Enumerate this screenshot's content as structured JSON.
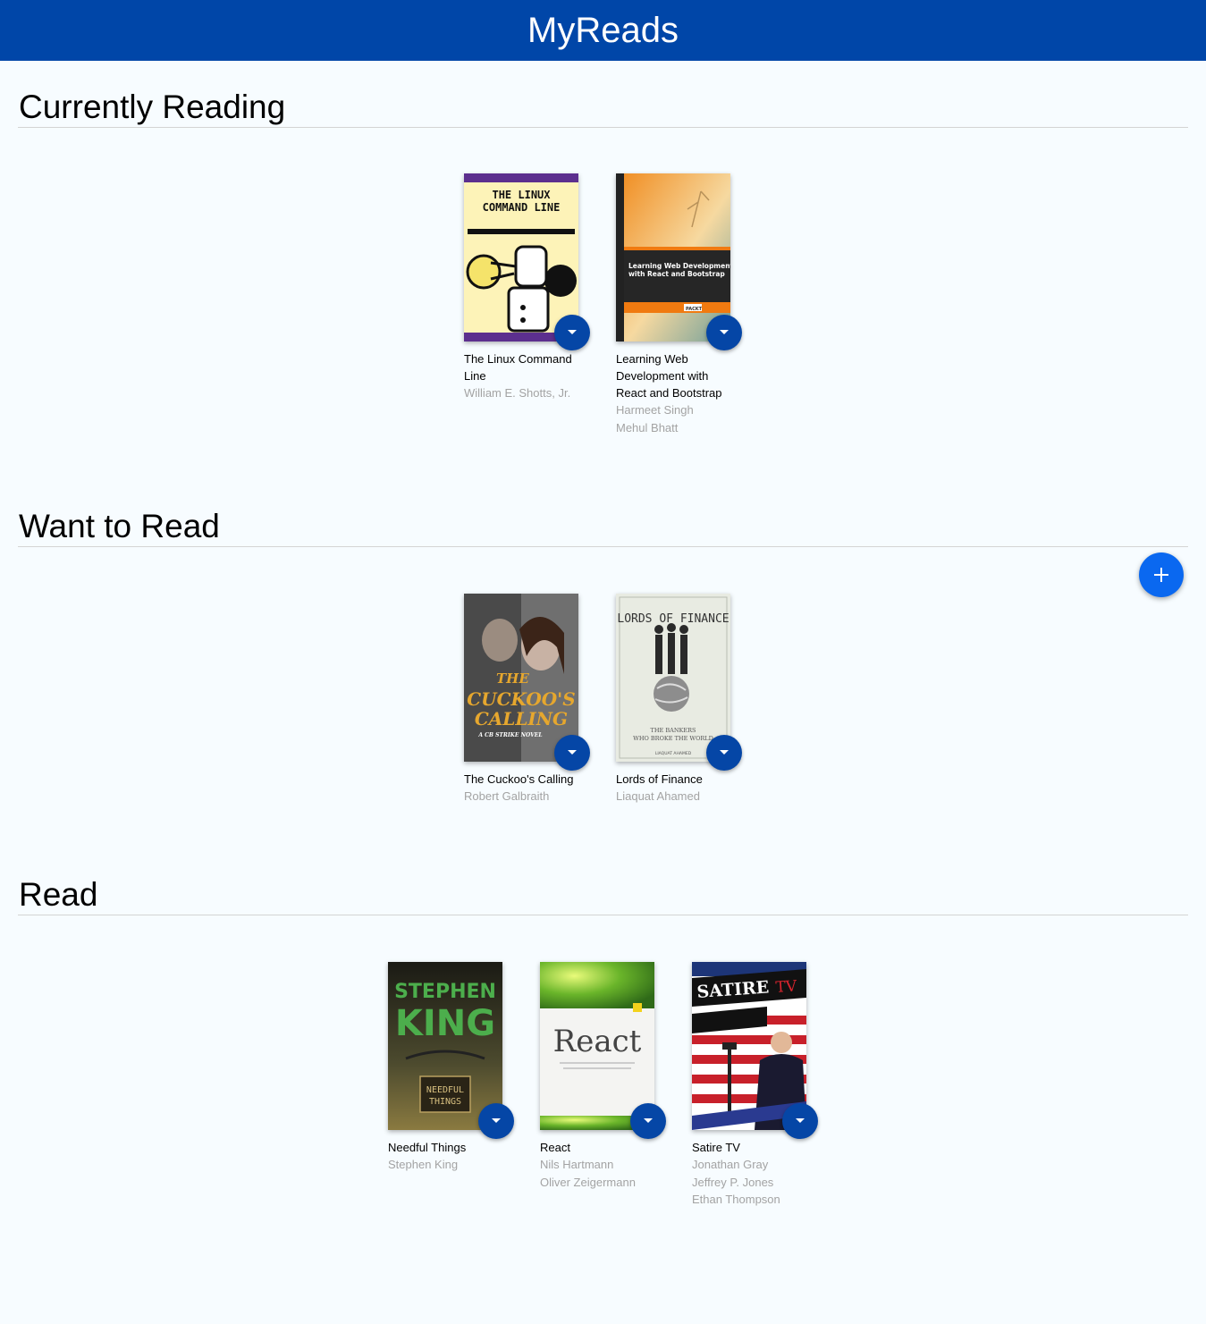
{
  "header": {
    "title": "MyReads"
  },
  "shelves": [
    {
      "title": "Currently Reading",
      "books": [
        {
          "title": "The Linux Command Line",
          "authors": [
            "William E. Shotts, Jr."
          ],
          "cover_text": [
            "THE LINUX",
            "COMMAND LINE"
          ]
        },
        {
          "title": "Learning Web Development with React and Bootstrap",
          "authors": [
            "Harmeet Singh",
            "Mehul Bhatt"
          ],
          "cover_text": [
            "Learning Web Development",
            "with React and Bootstrap",
            "PACKT"
          ]
        }
      ]
    },
    {
      "title": "Want to Read",
      "books": [
        {
          "title": "The Cuckoo's Calling",
          "authors": [
            "Robert Galbraith"
          ],
          "cover_text": [
            "THE",
            "CUCKOO'S",
            "CALLING",
            "A CB STRIKE NOVEL"
          ]
        },
        {
          "title": "Lords of Finance",
          "authors": [
            "Liaquat Ahamed"
          ],
          "cover_text": [
            "LORDS OF FINANCE",
            "THE BANKERS",
            "WHO BROKE THE WORLD",
            "LIAQUAT AHAMED"
          ]
        }
      ]
    },
    {
      "title": "Read",
      "books": [
        {
          "title": "Needful Things",
          "authors": [
            "Stephen King"
          ],
          "cover_text": [
            "STEPHEN",
            "KING",
            "NEEDFUL",
            "THINGS"
          ]
        },
        {
          "title": "React",
          "authors": [
            "Nils Hartmann",
            "Oliver Zeigermann"
          ],
          "cover_text": [
            "React"
          ]
        },
        {
          "title": "Satire TV",
          "authors": [
            "Jonathan Gray",
            "Jeffrey P. Jones",
            "Ethan Thompson"
          ],
          "cover_text": [
            "SATIRE",
            "TV"
          ]
        }
      ]
    }
  ],
  "icons": {
    "shelf_changer": "caret-down-icon",
    "add": "plus-icon"
  },
  "colors": {
    "header": "#0046a8",
    "shelf_changer": "#0546a6",
    "add_button": "#0a68f0",
    "background": "#f7fcff"
  }
}
